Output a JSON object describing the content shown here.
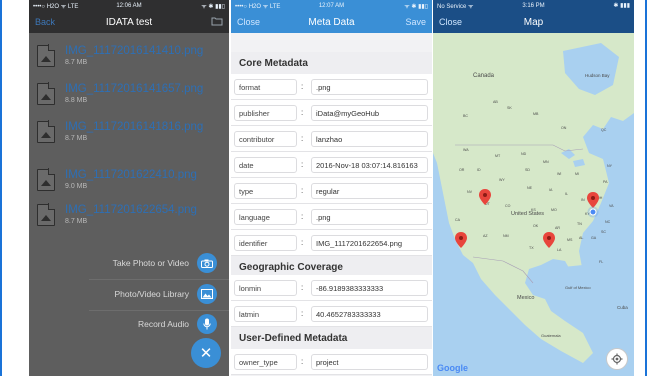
{
  "panel1": {
    "status": {
      "carrier": "••••○ H2O ᯤ LTE",
      "time": "12:06 AM",
      "battery": "ᯤ ✱ ▮▮▯"
    },
    "nav": {
      "back": "Back",
      "title": "IDATA test"
    },
    "files": [
      {
        "name": "IMG_11172016141410.png",
        "size": "8.7 MB"
      },
      {
        "name": "IMG_11172016141657.png",
        "size": "8.8 MB"
      },
      {
        "name": "IMG_11172016141816.png",
        "size": "8.7 MB"
      },
      {
        "name": "IMG_1117201622410.png",
        "size": "9.0 MB"
      },
      {
        "name": "IMG_1117201622654.png",
        "size": "8.7 MB"
      }
    ],
    "actions": [
      {
        "label": "Take Photo or Video",
        "icon": "camera-icon"
      },
      {
        "label": "Photo/Video Library",
        "icon": "photo-library-icon"
      },
      {
        "label": "Record Audio",
        "icon": "microphone-icon"
      }
    ],
    "fab_icon": "close-icon"
  },
  "panel2": {
    "status": {
      "carrier": "••••○ H2O ᯤ LTE",
      "time": "12:07 AM",
      "battery": "ᯤ ✱ ▮▮▯"
    },
    "nav": {
      "close": "Close",
      "title": "Meta Data",
      "save": "Save"
    },
    "core_title": "Core Metadata",
    "core": [
      {
        "label": "format",
        "value": ".png"
      },
      {
        "label": "publisher",
        "value": "iData@myGeoHub"
      },
      {
        "label": "contributor",
        "value": "lanzhao"
      },
      {
        "label": "date",
        "value": "2016-Nov-18 03:07:14.816163"
      },
      {
        "label": "type",
        "value": "regular"
      },
      {
        "label": "language",
        "value": ".png"
      },
      {
        "label": "identifier",
        "value": "IMG_1117201622654.png"
      }
    ],
    "geo_title": "Geographic Coverage",
    "geo": [
      {
        "label": "lonmin",
        "value": "-86.9189383333333"
      },
      {
        "label": "latmin",
        "value": "40.4652783333333"
      }
    ],
    "user_title": "User-Defined Metadata",
    "user": [
      {
        "label": "owner_type",
        "value": "project"
      }
    ]
  },
  "panel3": {
    "status": {
      "carrier": "No Service ᯤ",
      "time": "3:16 PM",
      "battery": "✱ ▮▮▮"
    },
    "nav": {
      "close": "Close",
      "title": "Map"
    },
    "map_labels": {
      "canada": "Canada",
      "hudson": "Hudson Bay",
      "us": "United States",
      "mexico": "Mexico",
      "gulf": "Gulf of Mexico",
      "cuba": "Cuba",
      "guatemala": "Guatemala",
      "ab": "AB",
      "sk": "SK",
      "mb": "MB",
      "on": "ON",
      "qc": "QC",
      "bc": "BC",
      "wa": "WA",
      "or": "OR",
      "id": "ID",
      "mt": "MT",
      "nd": "ND",
      "mn": "MN",
      "wi": "WI",
      "mi": "MI",
      "ny": "NY",
      "pa": "PA",
      "oh": "OH",
      "wy": "WY",
      "sd": "SD",
      "ne": "NE",
      "ia": "IA",
      "il": "IL",
      "in": "IN",
      "nv": "NV",
      "ut": "UT",
      "co": "CO",
      "ks": "KS",
      "mo": "MO",
      "ky": "KY",
      "va": "VA",
      "ca": "CA",
      "az": "AZ",
      "nm": "NM",
      "ok": "OK",
      "ar": "AR",
      "tn": "TN",
      "nc": "NC",
      "tx": "TX",
      "la": "LA",
      "ms": "MS",
      "al": "AL",
      "ga": "GA",
      "fl": "FL",
      "sc": "SC"
    },
    "google": "Google",
    "locate_icon": "locate-me-icon",
    "pin_icon": "map-pin-icon"
  },
  "colors": {
    "accent": "#3a8fd6",
    "pin": "#e8453c",
    "frame": "#1a73d8"
  }
}
